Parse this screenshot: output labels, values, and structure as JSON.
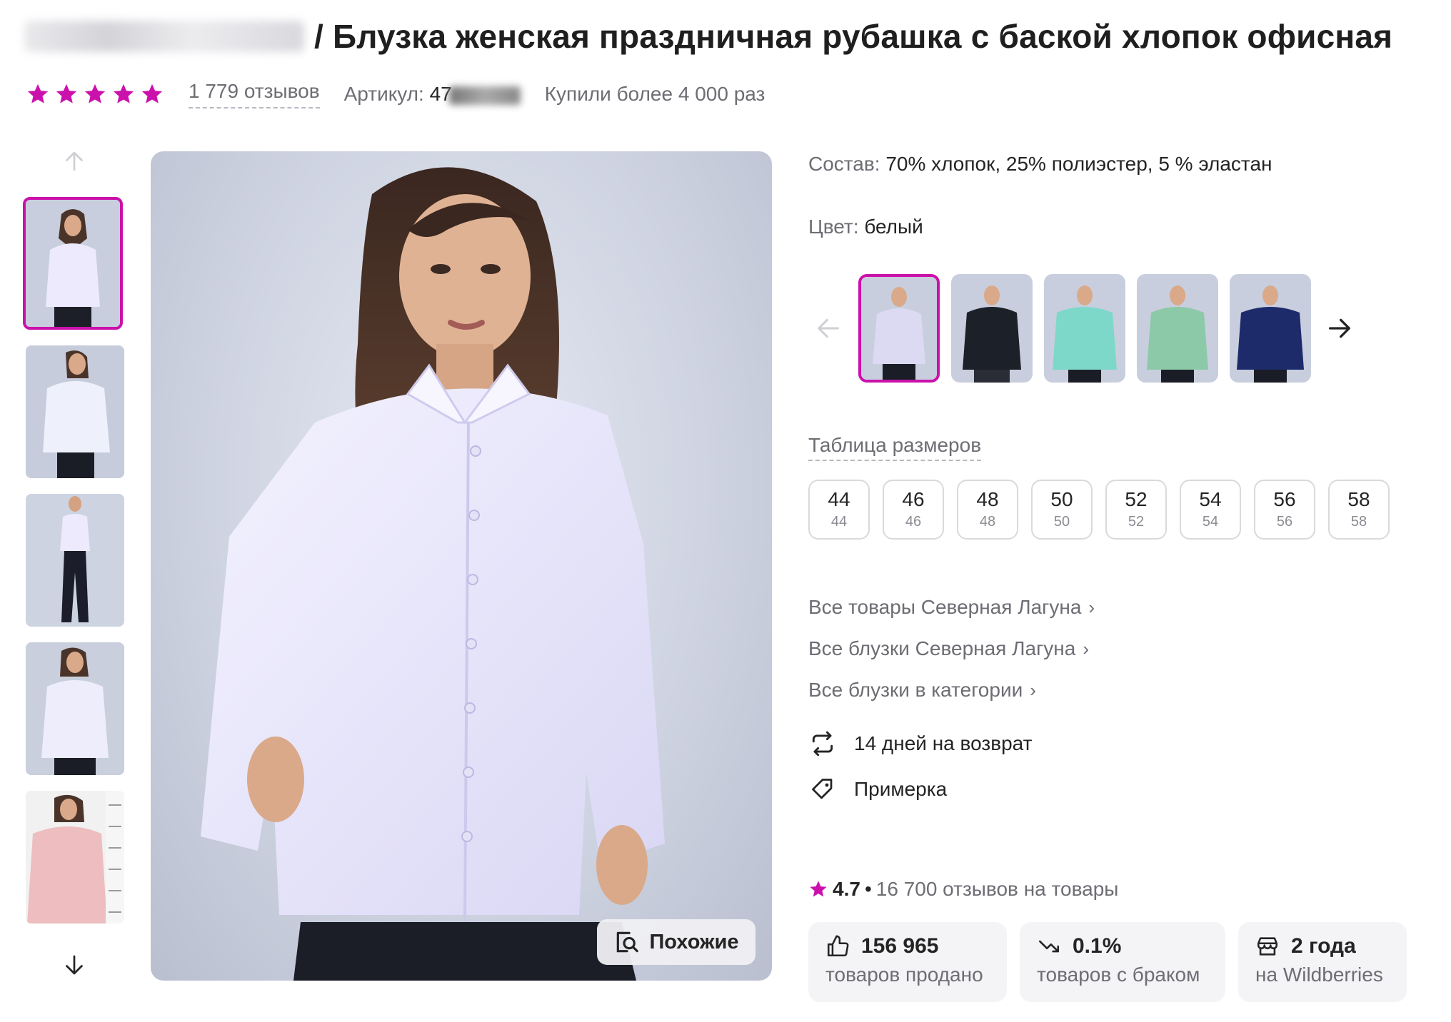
{
  "product": {
    "title": "/ Блузка женская праздничная рубашка с баской хлопок офисная",
    "reviews_label": "1 779 отзывов",
    "article_label": "Артикул:",
    "article_value": "47",
    "purchased": "Купили более 4 000 раз",
    "rating_stars": 5
  },
  "gallery": {
    "similar_label": "Похожие"
  },
  "specs": {
    "composition_label": "Состав:",
    "composition_value": "70% хлопок, 25% полиэстер, 5 % эластан",
    "color_label": "Цвет:",
    "color_value": "белый",
    "swatches": [
      {
        "name": "white",
        "color": "#dcd9f2"
      },
      {
        "name": "black",
        "color": "#1c2028"
      },
      {
        "name": "mint",
        "color": "#7ed8c9"
      },
      {
        "name": "sage",
        "color": "#8cc9a8"
      },
      {
        "name": "navy",
        "color": "#1d2b6b"
      }
    ]
  },
  "sizes": {
    "table_link": "Таблица размеров",
    "items": [
      {
        "big": "44",
        "small": "44"
      },
      {
        "big": "46",
        "small": "46"
      },
      {
        "big": "48",
        "small": "48"
      },
      {
        "big": "50",
        "small": "50"
      },
      {
        "big": "52",
        "small": "52"
      },
      {
        "big": "54",
        "small": "54"
      },
      {
        "big": "56",
        "small": "56"
      },
      {
        "big": "58",
        "small": "58"
      }
    ]
  },
  "links": [
    "Все товары Северная Лагуна",
    "Все блузки Северная Лагуна",
    "Все блузки в категории"
  ],
  "features": {
    "return": "14 дней на возврат",
    "fitting": "Примерка"
  },
  "seller": {
    "rating": "4.7",
    "dot": "•",
    "reviews": "16 700 отзывов на товары",
    "stats": [
      {
        "value": "156 965",
        "label": "товаров продано"
      },
      {
        "value": "0.1%",
        "label": "товаров с браком"
      },
      {
        "value": "2 года",
        "label": "на Wildberries"
      }
    ]
  },
  "colors": {
    "accent": "#cb11ab",
    "muted_text": "#6d6d74",
    "text": "#242424",
    "stat_bg": "#f4f4f7"
  }
}
